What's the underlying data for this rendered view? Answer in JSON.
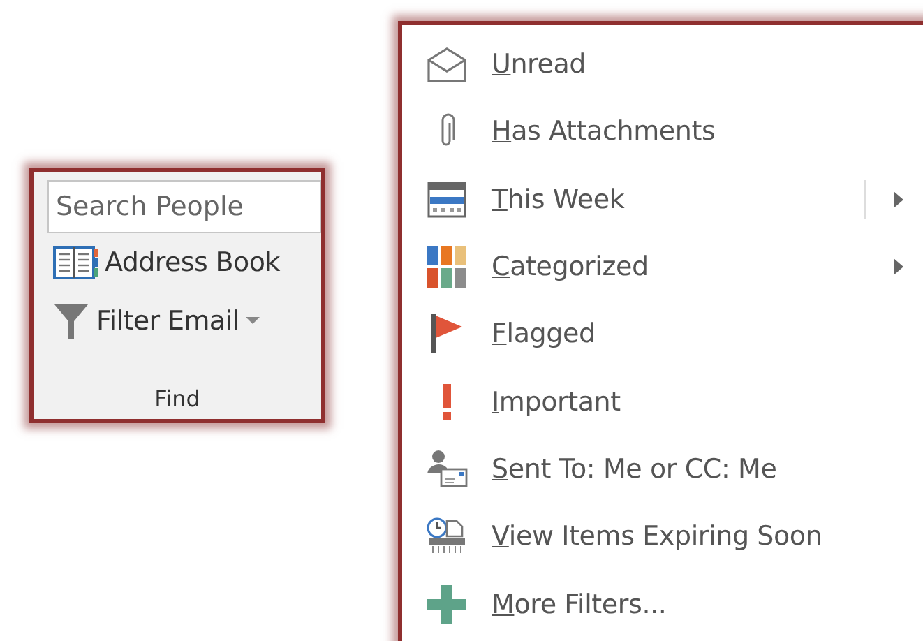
{
  "find_group": {
    "search": {
      "placeholder": "Search People"
    },
    "buttons": [
      {
        "kind": "book",
        "label": "Address Book",
        "dropdown": false
      },
      {
        "kind": "filter",
        "label": "Filter Email",
        "dropdown": true
      }
    ],
    "group_label": "Find"
  },
  "filter_menu": {
    "items": [
      {
        "kind": "envelope",
        "label": "Unread",
        "access_key_underlined": true,
        "submenu": false,
        "split": false
      },
      {
        "kind": "paperclip",
        "label": "Has Attachments",
        "access_key_underlined": true,
        "submenu": false,
        "split": false
      },
      {
        "kind": "calendar",
        "label": "This Week",
        "access_key_underlined": true,
        "submenu": true,
        "split": true
      },
      {
        "kind": "categories",
        "label": "Categorized",
        "access_key_underlined": true,
        "submenu": true,
        "split": false
      },
      {
        "kind": "flag",
        "label": "Flagged",
        "access_key_underlined": true,
        "submenu": false,
        "split": false
      },
      {
        "kind": "exclamation",
        "label": "Important",
        "access_key_underlined": true,
        "submenu": false,
        "split": false
      },
      {
        "kind": "person-mail",
        "label": "Sent To: Me or CC: Me",
        "access_key_underlined": true,
        "submenu": false,
        "split": false
      },
      {
        "kind": "clock-doc",
        "label": "View Items Expiring Soon",
        "access_key_underlined": true,
        "submenu": false,
        "split": false
      },
      {
        "kind": "plus",
        "label": "More Filters...",
        "access_key_underlined": true,
        "submenu": false,
        "split": false
      }
    ]
  }
}
